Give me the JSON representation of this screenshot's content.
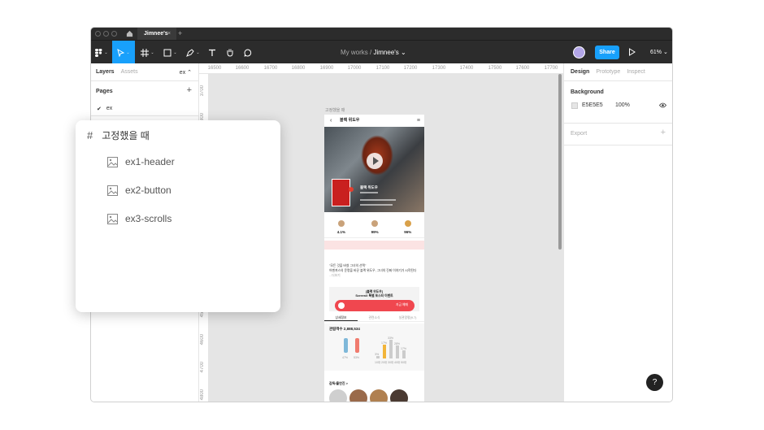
{
  "titlebar": {
    "tab_title": "Jimnee's",
    "tab_close": "×",
    "tab_add": "+"
  },
  "toolbar": {
    "breadcrumb_team": "My works",
    "breadcrumb_sep": "/",
    "breadcrumb_file": "Jimnee's ⌄",
    "share_label": "Share",
    "zoom_label": "61% ⌄",
    "caret": "⌄"
  },
  "left_panel": {
    "tab_layers": "Layers",
    "tab_assets": "Assets",
    "page_selector": "ex ⌃",
    "pages_heading": "Pages",
    "add_page": "+",
    "pages": [
      {
        "check": "✔",
        "label": "ex"
      }
    ]
  },
  "ruler": {
    "top": [
      "16500",
      "16600",
      "16700",
      "16800",
      "16900",
      "17000",
      "17100",
      "17200",
      "17300",
      "17400",
      "17500",
      "17600",
      "17700"
    ],
    "left": [
      "3700",
      "3800",
      "3900",
      "4000",
      "4100",
      "4200",
      "4300",
      "4400",
      "4500",
      "4600",
      "4700",
      "4800"
    ]
  },
  "right_panel": {
    "tab_design": "Design",
    "tab_prototype": "Prototype",
    "tab_inspect": "Inspect",
    "background_heading": "Background",
    "background_hex": "E5E5E5",
    "background_opacity": "100%",
    "export_heading": "Export",
    "export_add": "+"
  },
  "help_label": "?",
  "canvas_frame": {
    "label": "고정했을 때",
    "header_title": "블랙 위도우",
    "back": "‹",
    "menu": "≡",
    "poster_title": "블랙 위도우",
    "stats": [
      "4.1%",
      "99%",
      "96%"
    ],
    "desc_quote": "\"모든 것을 바쳤 그녀의 선택\"",
    "desc_body": "어벤져스의 운명을 바꾼 블랙 위도우, 그녀의 진짜 이야기가 시작된다",
    "desc_more": "...더보기",
    "event_line1": "[블랙 위도우]",
    "event_line2": "ScreenX 특별 포스터 이벤트",
    "event_button": "지금 예매",
    "tabs": [
      "상세정보",
      "관련소식",
      "실관람평(9.7)"
    ],
    "chart_title": "관람객수 2,888,534",
    "gender_pct": [
      "47%",
      "53%"
    ],
    "age_pct": [
      "3%",
      "17%",
      "33%",
      "28%",
      "17%"
    ],
    "age_labels": [
      "10대",
      "20대",
      "30대",
      "40대",
      "50대"
    ],
    "cast_title": "감독/출연진 >"
  },
  "popup": {
    "heading": "고정했을 때",
    "items": [
      "ex1-header",
      "ex2-button",
      "ex3-scrolls"
    ]
  },
  "colors": {
    "accent": "#18a0fb",
    "toolbar_bg": "#2c2c2c",
    "canvas_bg": "#e5e5e5",
    "event_red": "#f0474f"
  }
}
